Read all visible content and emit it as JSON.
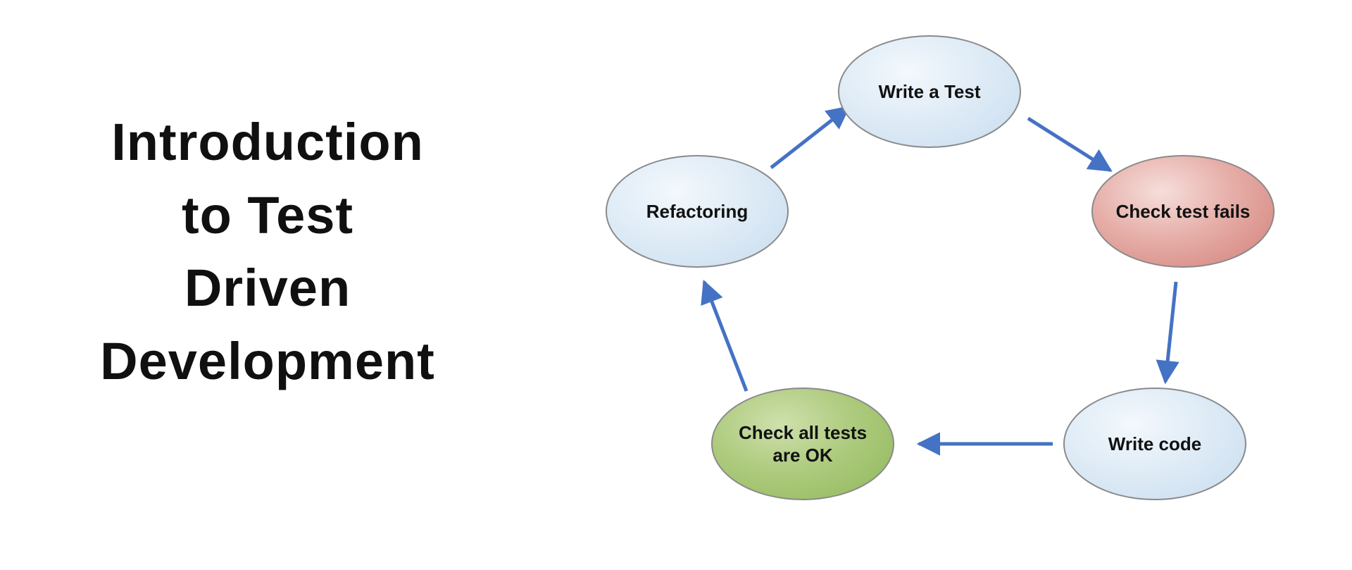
{
  "title": {
    "line1": "Introduction",
    "line2": "to Test",
    "line3": "Driven",
    "line4": "Development"
  },
  "nodes": {
    "write_test": "Write a Test",
    "check_fails": "Check test fails",
    "write_code": "Write code",
    "check_ok": "Check all tests are OK",
    "refactoring": "Refactoring"
  },
  "colors": {
    "arrow": "#4472C4",
    "node_blue": "#d3e4f3",
    "node_red": "#d27e78",
    "node_green": "#9ec36d",
    "node_border": "#8a8a8a",
    "text": "#111111"
  },
  "diagram_flow": [
    "write_test",
    "check_fails",
    "write_code",
    "check_ok",
    "refactoring",
    "write_test"
  ]
}
